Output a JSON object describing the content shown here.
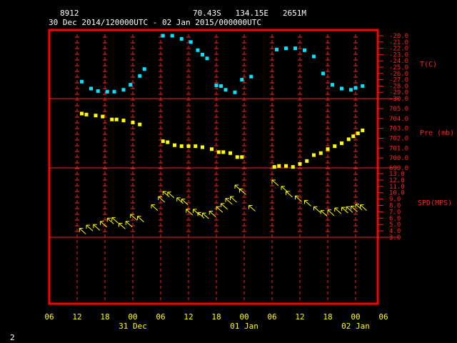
{
  "header": {
    "station_id": "8912",
    "location": "70.43S   134.15E   2651M",
    "time_range": "30 Dec 2014/120000UTC - 02 Jan 2015/000000UTC"
  },
  "footer_page": "2",
  "colors": {
    "background": "#000000",
    "frame": "#ff0000",
    "grid": "#ff2020",
    "temperature": "#00e5ff",
    "pressure": "#ffff00",
    "wind": "#ffff00",
    "header_text": "#ffffff",
    "time_axis_text": "#ffff00"
  },
  "chart_data": {
    "type": "scatter",
    "x_axis": {
      "unit": "hours since 30 Dec 2014 06 UTC",
      "range": [
        0,
        72
      ],
      "tick_labels": [
        "06",
        "12",
        "18",
        "00",
        "06",
        "12",
        "18",
        "00",
        "06",
        "12",
        "18",
        "00",
        "06"
      ],
      "date_labels": [
        {
          "label": "31 Dec",
          "at": 18
        },
        {
          "label": "01 Jan",
          "at": 42
        },
        {
          "label": "02 Jan",
          "at": 66
        }
      ]
    },
    "panels": [
      {
        "name": "T(C)",
        "range": [
          -30,
          -20
        ],
        "tick_labels": [
          "-20.0",
          "-21.0",
          "-22.0",
          "-23.0",
          "-24.0",
          "-25.0",
          "-26.0",
          "-27.0",
          "-28.0",
          "-29.0",
          "-30.0"
        ],
        "marker": "square",
        "points": [
          [
            7,
            -27.3
          ],
          [
            9,
            -28.4
          ],
          [
            10.5,
            -28.8
          ],
          [
            12.5,
            -28.9
          ],
          [
            14,
            -28.9
          ],
          [
            16,
            -28.6
          ],
          [
            17.5,
            -27.8
          ],
          [
            19.5,
            -26.4
          ],
          [
            20.5,
            -25.3
          ],
          [
            24.5,
            -20.0
          ],
          [
            26.5,
            -20.0
          ],
          [
            28.5,
            -20.5
          ],
          [
            30.5,
            -21.0
          ],
          [
            32,
            -22.3
          ],
          [
            33,
            -23.0
          ],
          [
            34,
            -23.6
          ],
          [
            36,
            -27.9
          ],
          [
            37,
            -28.0
          ],
          [
            38,
            -28.6
          ],
          [
            40,
            -29.0
          ],
          [
            41.5,
            -27.0
          ],
          [
            43.5,
            -26.5
          ],
          [
            49,
            -22.2
          ],
          [
            51,
            -22.0
          ],
          [
            53,
            -22.0
          ],
          [
            55,
            -22.3
          ],
          [
            57,
            -23.3
          ],
          [
            59,
            -26.0
          ],
          [
            61,
            -27.8
          ],
          [
            63,
            -28.4
          ],
          [
            65,
            -28.6
          ],
          [
            66,
            -28.3
          ],
          [
            67.5,
            -28.0
          ]
        ]
      },
      {
        "name": "Pre (mb)",
        "range": [
          699,
          706
        ],
        "tick_labels": [
          "705.0",
          "704.0",
          "703.0",
          "702.0",
          "701.0",
          "700.0",
          "699.0"
        ],
        "marker": "square",
        "points": [
          [
            7,
            704.5
          ],
          [
            8,
            704.4
          ],
          [
            10,
            704.3
          ],
          [
            11.5,
            704.2
          ],
          [
            13.5,
            703.9
          ],
          [
            14.5,
            703.9
          ],
          [
            16,
            703.8
          ],
          [
            18,
            703.6
          ],
          [
            19.5,
            703.4
          ],
          [
            24.5,
            701.7
          ],
          [
            25.5,
            701.6
          ],
          [
            27,
            701.3
          ],
          [
            28.5,
            701.2
          ],
          [
            30,
            701.2
          ],
          [
            31.5,
            701.2
          ],
          [
            33,
            701.1
          ],
          [
            35,
            700.9
          ],
          [
            36.5,
            700.6
          ],
          [
            37.5,
            700.6
          ],
          [
            39,
            700.5
          ],
          [
            40.5,
            700.1
          ],
          [
            41.5,
            700.1
          ],
          [
            48.5,
            699.1
          ],
          [
            49.5,
            699.2
          ],
          [
            51,
            699.2
          ],
          [
            52.5,
            699.1
          ],
          [
            54,
            699.4
          ],
          [
            55.5,
            699.7
          ],
          [
            57,
            700.3
          ],
          [
            58.5,
            700.5
          ],
          [
            60,
            700.9
          ],
          [
            61.5,
            701.2
          ],
          [
            63,
            701.5
          ],
          [
            64.5,
            701.9
          ],
          [
            65.5,
            702.2
          ],
          [
            66.5,
            702.5
          ],
          [
            67.5,
            702.8
          ]
        ]
      },
      {
        "name": "SPD(MPS)",
        "range": [
          3,
          13
        ],
        "tick_labels": [
          "13.0",
          "12.0",
          "11.0",
          "10.0",
          "9.0",
          "8.0",
          "7.0",
          "6.0",
          "5.0",
          "4.0",
          "3.0"
        ],
        "marker": "wind-arrow",
        "points": [
          [
            6.5,
            4.4
          ],
          [
            8,
            4.9
          ],
          [
            9.5,
            5.0
          ],
          [
            11,
            5.5
          ],
          [
            12.5,
            6.0
          ],
          [
            13.5,
            6.1
          ],
          [
            15,
            5.2
          ],
          [
            16.5,
            5.5
          ],
          [
            17.5,
            6.6
          ],
          [
            19,
            6.3
          ],
          [
            22,
            8.1
          ],
          [
            23.5,
            9.4
          ],
          [
            24.5,
            10.2
          ],
          [
            25.5,
            10.1
          ],
          [
            27.5,
            9.2
          ],
          [
            28.5,
            9.0
          ],
          [
            29.5,
            7.4
          ],
          [
            31,
            7.4
          ],
          [
            32,
            6.9
          ],
          [
            33,
            6.8
          ],
          [
            34.5,
            7.1
          ],
          [
            36,
            7.8
          ],
          [
            37,
            8.3
          ],
          [
            38,
            9.1
          ],
          [
            39,
            9.4
          ],
          [
            40,
            11.2
          ],
          [
            41,
            10.6
          ],
          [
            43,
            8.0
          ],
          [
            48,
            12.0
          ],
          [
            50,
            11.0
          ],
          [
            51,
            10.2
          ],
          [
            53,
            9.5
          ],
          [
            55,
            8.8
          ],
          [
            57,
            7.8
          ],
          [
            58.5,
            7.2
          ],
          [
            60,
            7.3
          ],
          [
            61.5,
            7.6
          ],
          [
            63,
            7.7
          ],
          [
            64,
            7.8
          ],
          [
            65,
            7.9
          ],
          [
            66,
            8.2
          ],
          [
            67,
            8.1
          ]
        ]
      }
    ],
    "grid": true
  }
}
